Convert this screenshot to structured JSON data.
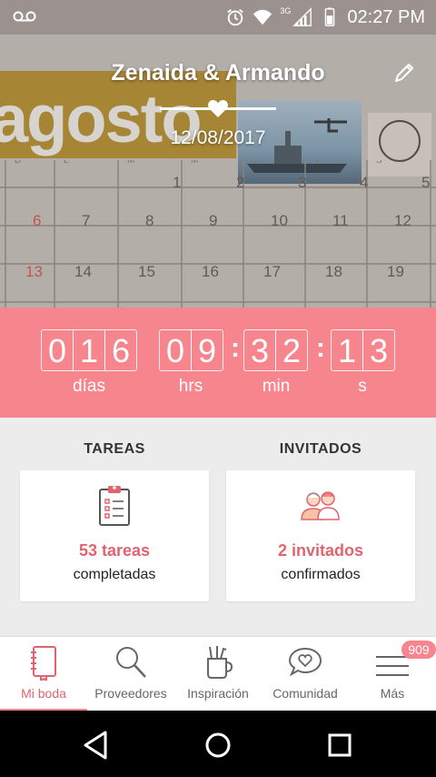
{
  "status_bar": {
    "time": "02:27 PM",
    "network": "3G",
    "icons": [
      "voicemail-icon",
      "alarm-icon",
      "wifi-icon",
      "signal-icon",
      "battery-icon"
    ]
  },
  "header": {
    "couple_name": "Zenaida & Armando",
    "wedding_date": "12/08/2017",
    "calendar_month_word": "agosto",
    "calendar_days_row1": [
      "1",
      "2",
      "3",
      "4",
      "5"
    ],
    "calendar_days_row2": [
      "6",
      "7",
      "8",
      "9",
      "10",
      "11",
      "12"
    ],
    "calendar_days_row3": [
      "13",
      "14",
      "15",
      "16",
      "17",
      "18",
      "19"
    ],
    "calendar_weekdays": [
      "D",
      "L",
      "M",
      "M",
      "J",
      "V",
      "S"
    ]
  },
  "countdown": {
    "days_digits": [
      "0",
      "1",
      "6"
    ],
    "hours_digits": [
      "0",
      "9"
    ],
    "minutes_digits": [
      "3",
      "2"
    ],
    "seconds_digits": [
      "1",
      "3"
    ],
    "separator": ":",
    "labels": {
      "days": "días",
      "hours": "hrs",
      "minutes": "min",
      "seconds": "s"
    }
  },
  "sections": {
    "tasks": {
      "title": "TAREAS",
      "main": "53 tareas",
      "sub": "completadas",
      "icon": "clipboard-icon"
    },
    "guests": {
      "title": "INVITADOS",
      "main": "2 invitados",
      "sub": "confirmados",
      "icon": "guests-icon"
    }
  },
  "bottom_nav": {
    "items": [
      {
        "label": "Mi boda",
        "icon": "notebook-icon",
        "active": true
      },
      {
        "label": "Proveedores",
        "icon": "search-icon",
        "active": false
      },
      {
        "label": "Inspiración",
        "icon": "inspiration-cup-icon",
        "active": false
      },
      {
        "label": "Comunidad",
        "icon": "chat-heart-icon",
        "active": false
      },
      {
        "label": "Más",
        "icon": "menu-icon",
        "active": false,
        "badge": "909"
      }
    ]
  },
  "colors": {
    "accent": "#f6858e",
    "accent_text": "#e0646f",
    "status_bar": "#9b9290"
  }
}
